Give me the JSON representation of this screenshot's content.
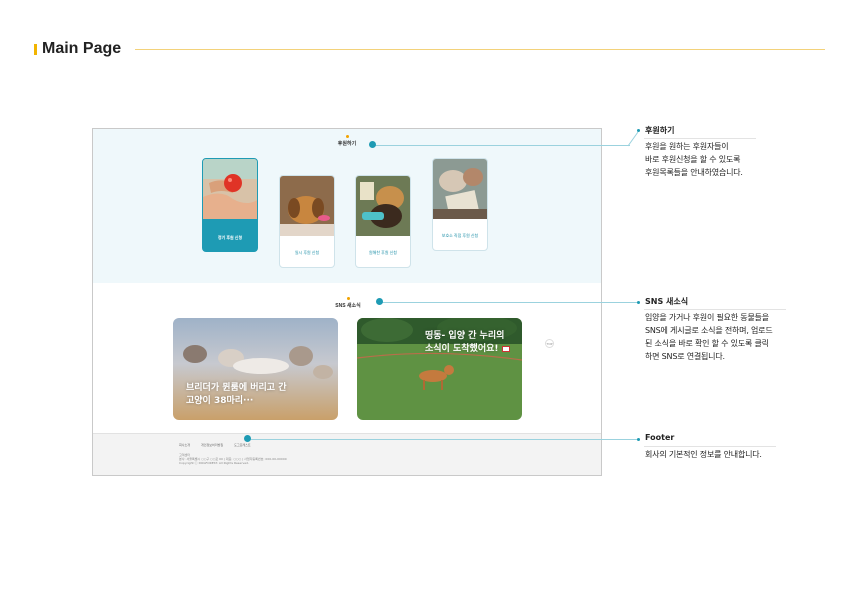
{
  "header": {
    "title": "Main Page",
    "accent": "#f2b400"
  },
  "mockup": {
    "donate": {
      "title": "후원하기",
      "cards": [
        {
          "label": "정기 후원 신청",
          "active": true
        },
        {
          "label": "일시 후원 신청",
          "active": false
        },
        {
          "label": "원해찬 후원 신청",
          "active": false
        },
        {
          "label": "보호소 직접 후원 신청",
          "active": false
        }
      ]
    },
    "sns": {
      "title": "SNS 새소식",
      "posts": [
        {
          "line1": "브리더가 뮌룸에 버리고 간",
          "line2": "고양이 38마리···"
        },
        {
          "line1": "띵동- 입양 간 누리의",
          "line2": "소식이 도착했어요!"
        }
      ],
      "top_button": "TOP"
    },
    "footer": {
      "links": [
        "회사소개",
        "개인정보처리방침",
        "도그포레스트"
      ],
      "info": [
        "고객센터",
        "본사: 서울특별시 ○○구 ○○로 00 | 대표: ○○○ | 사업자등록번호: 000-00-00000",
        "Copyright ⓒ DOGFOREST. All Rights Reserved."
      ]
    }
  },
  "annotations": [
    {
      "title": "후원하기",
      "body": "후원을 원하는 후원자들이\n바로 후원신청을 할 수 있도록\n후원목록들을 안내하였습니다."
    },
    {
      "title": "SNS 새소식",
      "body": "입양을 가거나 후원이 필요한 동물들을\nSNS에 게시글로 소식을 전하며, 업로드\n된 소식을 바로 확인 할 수 있도록 클릭\n하면 SNS로 연결됩니다."
    },
    {
      "title": "Footer",
      "body": "회사의 기본적인 정보를 안내합니다."
    }
  ],
  "colors": {
    "accent": "#1e9bb4",
    "donate_bg": "#eff8fb",
    "footer_bg": "#f3f3f3"
  }
}
